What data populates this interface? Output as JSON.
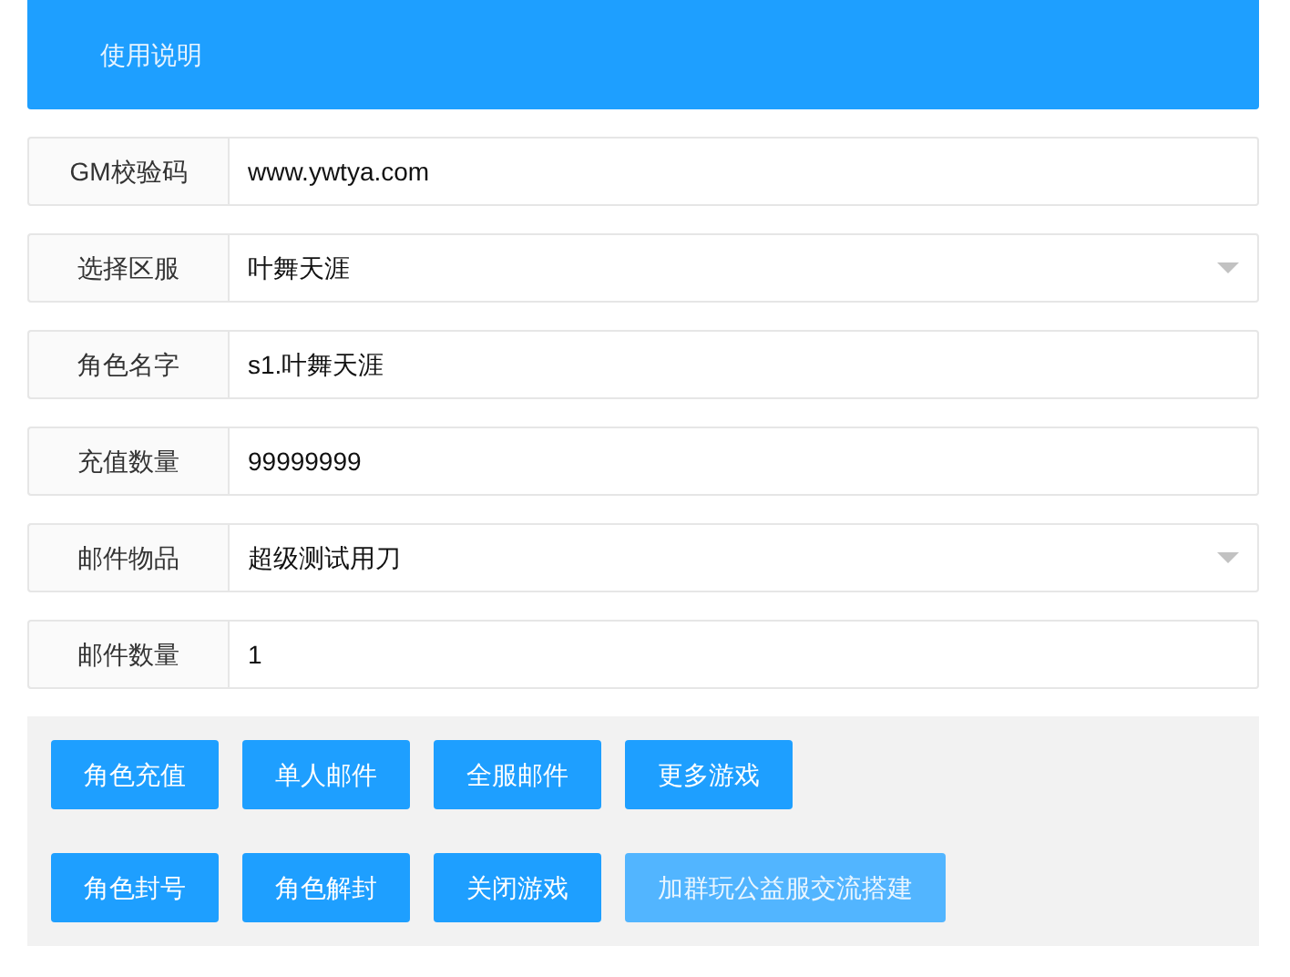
{
  "header": {
    "title": "使用说明"
  },
  "fields": [
    {
      "label": "GM校验码",
      "kind": "input",
      "value": "www.ywtya.com"
    },
    {
      "label": "选择区服",
      "kind": "select",
      "value": "叶舞天涯"
    },
    {
      "label": "角色名字",
      "kind": "input",
      "value": "s1.叶舞天涯"
    },
    {
      "label": "充值数量",
      "kind": "input",
      "value": "99999999"
    },
    {
      "label": "邮件物品",
      "kind": "select",
      "value": "超级测试用刀"
    },
    {
      "label": "邮件数量",
      "kind": "input",
      "value": "1"
    }
  ],
  "button_rows": [
    [
      {
        "label": "角色充值",
        "disabled": false
      },
      {
        "label": "单人邮件",
        "disabled": false
      },
      {
        "label": "全服邮件",
        "disabled": false
      },
      {
        "label": "更多游戏",
        "disabled": false
      }
    ],
    [
      {
        "label": "角色封号",
        "disabled": false
      },
      {
        "label": "角色解封",
        "disabled": false
      },
      {
        "label": "关闭游戏",
        "disabled": false
      },
      {
        "label": "加群玩公益服交流搭建",
        "disabled": true
      }
    ]
  ]
}
